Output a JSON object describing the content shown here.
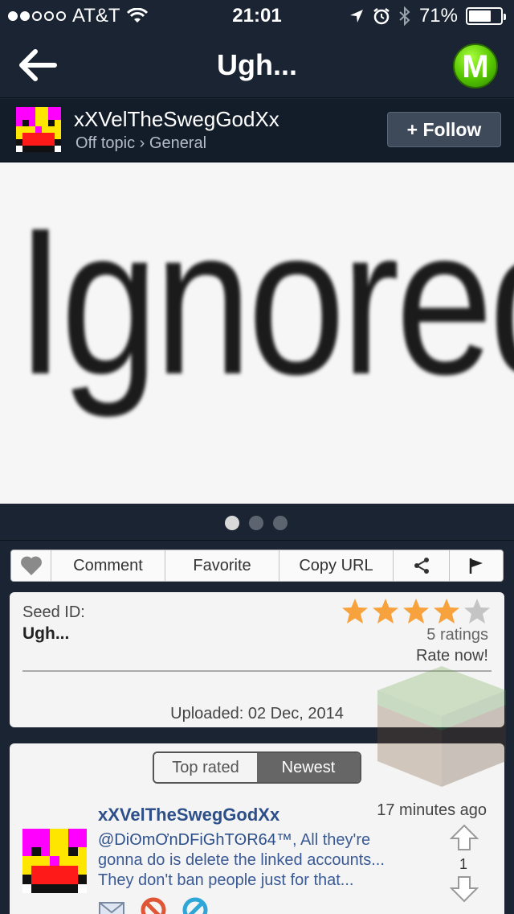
{
  "status_bar": {
    "carrier": "AT&T",
    "time": "21:01",
    "battery": "71%",
    "battery_level": 0.71,
    "signal_bars_filled": 2,
    "signal_bars_total": 5
  },
  "nav": {
    "title": "Ugh...",
    "logo_letter": "M"
  },
  "author": {
    "name": "xXVelTheSwegGodXx",
    "category_path": "Off topic › General",
    "follow_label": "+ Follow"
  },
  "post_image": {
    "text": "Ignored"
  },
  "pager": {
    "pages": 3,
    "active": 0
  },
  "actions": {
    "like_icon": "heart-icon",
    "comment": "Comment",
    "favorite": "Favorite",
    "copy_url": "Copy URL",
    "share_icon": "share-icon",
    "report_icon": "flag-icon"
  },
  "seed": {
    "id_label": "Seed ID:",
    "id_value": "Ugh...",
    "rating": 4,
    "max_rating": 5,
    "ratings_count": "5 ratings",
    "rate_now": "Rate now!",
    "uploaded": "Uploaded: 02 Dec, 2014"
  },
  "comments": {
    "tabs": [
      "Top rated",
      "Newest"
    ],
    "active_tab": 1,
    "items": [
      {
        "user": "xXVelTheSwegGodXx",
        "time": "17 minutes ago",
        "mention": "@DiʘmƠnDFiGhTʘR64™",
        "text": ", All they're gonna do is delete the linked accounts... They don't ban people just for that...",
        "score": "1"
      }
    ]
  },
  "colors": {
    "nav_bg": "#1a2433",
    "author_bg": "#131c29",
    "star_on": "#f7a23c",
    "star_off": "#c4c4c4",
    "link_blue": "#2c4f8a"
  }
}
